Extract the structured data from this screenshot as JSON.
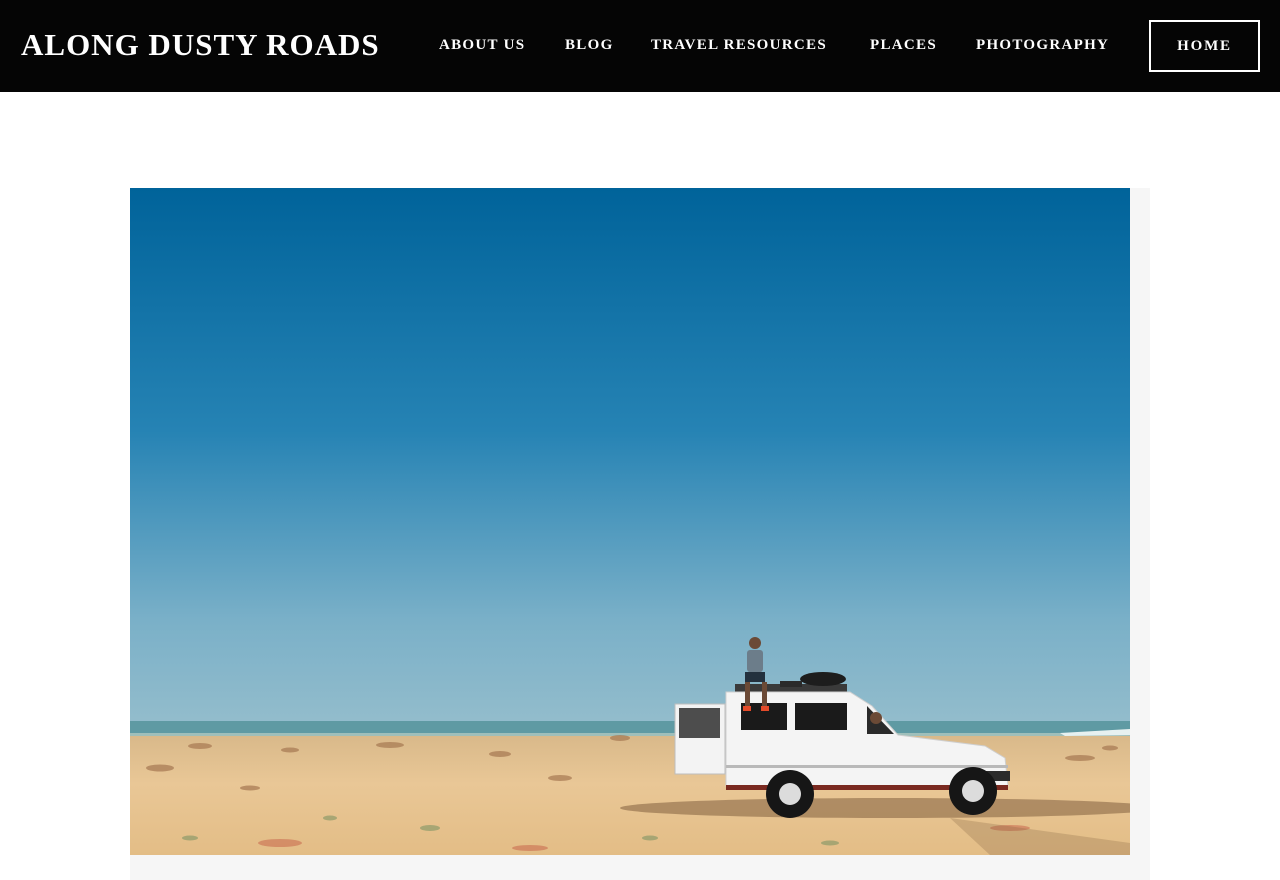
{
  "site": {
    "brand": "ALONG DUSTY ROADS"
  },
  "nav": {
    "items": [
      {
        "label": "ABOUT US"
      },
      {
        "label": "BLOG"
      },
      {
        "label": "TRAVEL RESOURCES"
      },
      {
        "label": "PLACES"
      },
      {
        "label": "PHOTOGRAPHY"
      }
    ],
    "home_label": "HOME"
  },
  "colors": {
    "header_bg": "#050505",
    "sky_top": "#00639a",
    "sky_bottom": "#8ab8cc",
    "sand": "#e6c493"
  }
}
